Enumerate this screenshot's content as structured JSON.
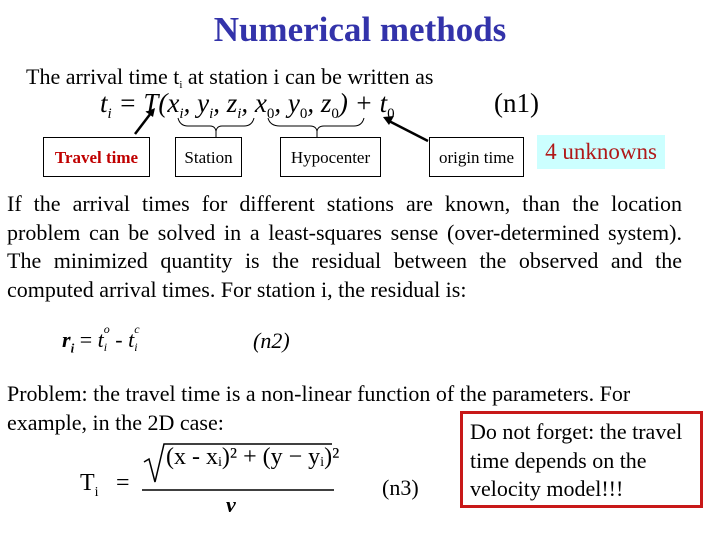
{
  "title": "Numerical methods",
  "intro": {
    "before": "The arrival time t",
    "sub": "i",
    "after": " at station i can be written as"
  },
  "equation1": {
    "lhs": "t",
    "lhs_sub": "i",
    "body": "= T(x",
    "parts": [
      "i",
      ", y",
      "i",
      ", z",
      "i",
      ", x",
      "0",
      ", y",
      "0",
      ", z",
      "0",
      ") + t",
      "0"
    ],
    "number": "(n1)"
  },
  "labels": {
    "travel_time": "Travel time",
    "station": "Station",
    "hypocenter": "Hypocenter",
    "origin_time": "origin time",
    "unknowns": "4 unknowns"
  },
  "paragraph": "If the arrival times for different stations are known, than the location problem can be solved in a least-squares sense (over-determined system). The minimized quantity is the residual between the observed and the computed arrival times. For station i, the residual is:",
  "equation2": {
    "lhs": "r",
    "lhs_sub": "i",
    "eq": " = ",
    "t1": "t",
    "t1_sup": "o",
    "t1_sub": "i",
    "minus": " - ",
    "t2": "t",
    "t2_sup": "c",
    "t2_sub": "i",
    "number": "(n2)"
  },
  "problem": "Problem: the travel time is a non-linear function of the parameters. For example, in the 2D case:",
  "note": "Do not forget: the travel time depends on the velocity model!!!",
  "equation3": {
    "lhs": "T",
    "lhs_sub": "i",
    "numerator": "(x - xᵢ)² + (y − yᵢ)²",
    "denominator": "v",
    "number": "(n3)"
  },
  "colors": {
    "title": "#3333aa",
    "travel_time": "#c00000",
    "unknowns_text": "#b01818",
    "unknowns_bg": "#ccffff",
    "note_border": "#c81818"
  }
}
